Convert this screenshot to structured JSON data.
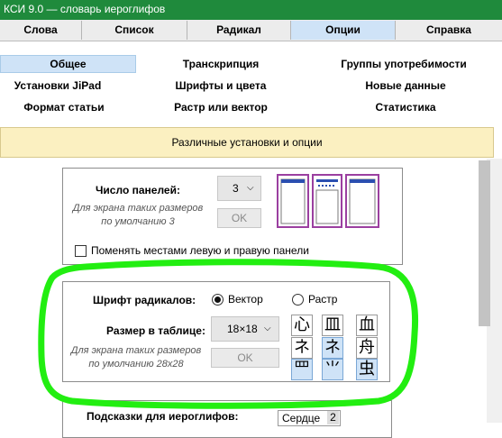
{
  "title": "КСИ 9.0 — словарь иероглифов",
  "tabs": [
    "Слова",
    "Список",
    "Радикал",
    "Опции",
    "Справка"
  ],
  "active_tab": "Опции",
  "subtabs": {
    "row1": [
      "Общее",
      "Транскрипция",
      "Группы употребимости"
    ],
    "row2": [
      "Установки JiPad",
      "Шрифты и цвета",
      "Новые данные"
    ],
    "row3": [
      "Формат статьи",
      "Растр или вектор",
      "Статистика"
    ]
  },
  "banner": "Различные установки и опции",
  "panels_section": {
    "label": "Число панелей:",
    "value": "3",
    "hint_line1": "Для экрана таких размеров",
    "hint_line2": "по умолчанию 3",
    "ok": "OK",
    "swap_label": "Поменять местами левую и правую панели"
  },
  "radical_section": {
    "font_label": "Шрифт радикалов:",
    "option_vector": "Вектор",
    "option_raster": "Растр",
    "selected": "Вектор",
    "size_label": "Размер в таблице:",
    "size_value": "18×18",
    "hint_line1": "Для экрана таких размеров",
    "hint_line2": "по умолчанию 28x28",
    "ok": "OK",
    "kanji": [
      "心",
      "皿",
      "血",
      "ネ",
      "ネ",
      "舟",
      "罒",
      "⺌",
      "虫"
    ]
  },
  "hints_section": {
    "label": "Подсказки для иероглифов:",
    "field_value": "Сердце",
    "field_num": "2"
  },
  "colors": {
    "titlebar": "#1f8a3c",
    "active_tab": "#cfe3f7",
    "banner": "#fbf0c1",
    "highlight_circle": "#22ee11",
    "layout_icon": "#9b3fa0"
  }
}
